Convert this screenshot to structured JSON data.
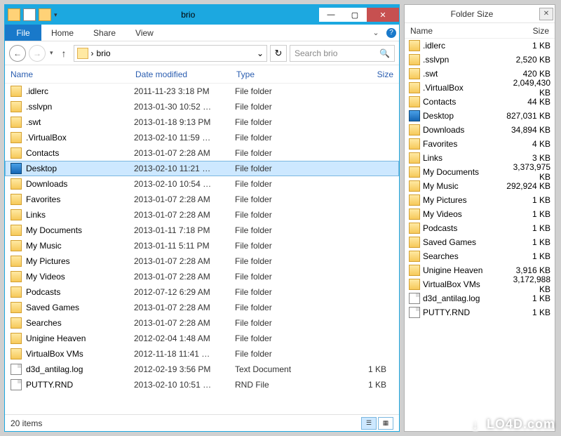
{
  "explorer": {
    "title": "brio",
    "ribbon": {
      "file": "File",
      "home": "Home",
      "share": "Share",
      "view": "View"
    },
    "address": {
      "crumb_sep": "›",
      "location": "brio",
      "dropdown_glyph": "⌄"
    },
    "search": {
      "placeholder": "Search brio"
    },
    "columns": {
      "name": "Name",
      "date": "Date modified",
      "type": "Type",
      "size": "Size"
    },
    "files": [
      {
        "icon": "folder",
        "name": ".idlerc",
        "date": "2011-11-23 3:18 PM",
        "type": "File folder",
        "size": ""
      },
      {
        "icon": "folder",
        "name": ".sslvpn",
        "date": "2013-01-30 10:52 …",
        "type": "File folder",
        "size": ""
      },
      {
        "icon": "folder",
        "name": ".swt",
        "date": "2013-01-18 9:13 PM",
        "type": "File folder",
        "size": ""
      },
      {
        "icon": "folder",
        "name": ".VirtualBox",
        "date": "2013-02-10 11:59 …",
        "type": "File folder",
        "size": ""
      },
      {
        "icon": "folder",
        "name": "Contacts",
        "date": "2013-01-07 2:28 AM",
        "type": "File folder",
        "size": ""
      },
      {
        "icon": "desktop",
        "name": "Desktop",
        "date": "2013-02-10 11:21 …",
        "type": "File folder",
        "size": "",
        "selected": true
      },
      {
        "icon": "folder",
        "name": "Downloads",
        "date": "2013-02-10 10:54 …",
        "type": "File folder",
        "size": ""
      },
      {
        "icon": "folder",
        "name": "Favorites",
        "date": "2013-01-07 2:28 AM",
        "type": "File folder",
        "size": ""
      },
      {
        "icon": "folder",
        "name": "Links",
        "date": "2013-01-07 2:28 AM",
        "type": "File folder",
        "size": ""
      },
      {
        "icon": "folder",
        "name": "My Documents",
        "date": "2013-01-11 7:18 PM",
        "type": "File folder",
        "size": ""
      },
      {
        "icon": "folder",
        "name": "My Music",
        "date": "2013-01-11 5:11 PM",
        "type": "File folder",
        "size": ""
      },
      {
        "icon": "folder",
        "name": "My Pictures",
        "date": "2013-01-07 2:28 AM",
        "type": "File folder",
        "size": ""
      },
      {
        "icon": "folder",
        "name": "My Videos",
        "date": "2013-01-07 2:28 AM",
        "type": "File folder",
        "size": ""
      },
      {
        "icon": "folder",
        "name": "Podcasts",
        "date": "2012-07-12 6:29 AM",
        "type": "File folder",
        "size": ""
      },
      {
        "icon": "folder",
        "name": "Saved Games",
        "date": "2013-01-07 2:28 AM",
        "type": "File folder",
        "size": ""
      },
      {
        "icon": "folder",
        "name": "Searches",
        "date": "2013-01-07 2:28 AM",
        "type": "File folder",
        "size": ""
      },
      {
        "icon": "folder",
        "name": "Unigine Heaven",
        "date": "2012-02-04 1:48 AM",
        "type": "File folder",
        "size": ""
      },
      {
        "icon": "folder",
        "name": "VirtualBox VMs",
        "date": "2012-11-18 11:41 …",
        "type": "File folder",
        "size": ""
      },
      {
        "icon": "doc",
        "name": "d3d_antilag.log",
        "date": "2012-02-19 3:56 PM",
        "type": "Text Document",
        "size": "1 KB"
      },
      {
        "icon": "doc",
        "name": "PUTTY.RND",
        "date": "2013-02-10 10:51 …",
        "type": "RND File",
        "size": "1 KB"
      }
    ],
    "status": "20 items"
  },
  "foldersize": {
    "title": "Folder Size",
    "columns": {
      "name": "Name",
      "size": "Size"
    },
    "rows": [
      {
        "icon": "folder",
        "name": ".idlerc",
        "size": "1 KB"
      },
      {
        "icon": "folder",
        "name": ".sslvpn",
        "size": "2,520 KB"
      },
      {
        "icon": "folder",
        "name": ".swt",
        "size": "420 KB"
      },
      {
        "icon": "folder",
        "name": ".VirtualBox",
        "size": "2,049,430 KB"
      },
      {
        "icon": "folder",
        "name": "Contacts",
        "size": "44 KB"
      },
      {
        "icon": "desktop",
        "name": "Desktop",
        "size": "827,031 KB"
      },
      {
        "icon": "folder",
        "name": "Downloads",
        "size": "34,894 KB"
      },
      {
        "icon": "folder",
        "name": "Favorites",
        "size": "4 KB"
      },
      {
        "icon": "folder",
        "name": "Links",
        "size": "3 KB"
      },
      {
        "icon": "folder",
        "name": "My Documents",
        "size": "3,373,975 KB"
      },
      {
        "icon": "folder",
        "name": "My Music",
        "size": "292,924 KB"
      },
      {
        "icon": "folder",
        "name": "My Pictures",
        "size": "1 KB"
      },
      {
        "icon": "folder",
        "name": "My Videos",
        "size": "1 KB"
      },
      {
        "icon": "folder",
        "name": "Podcasts",
        "size": "1 KB"
      },
      {
        "icon": "folder",
        "name": "Saved Games",
        "size": "1 KB"
      },
      {
        "icon": "folder",
        "name": "Searches",
        "size": "1 KB"
      },
      {
        "icon": "folder",
        "name": "Unigine Heaven",
        "size": "3,916 KB"
      },
      {
        "icon": "folder",
        "name": "VirtualBox VMs",
        "size": "3,172,988 KB"
      },
      {
        "icon": "doc",
        "name": "d3d_antilag.log",
        "size": "1 KB"
      },
      {
        "icon": "doc",
        "name": "PUTTY.RND",
        "size": "1 KB"
      }
    ]
  },
  "watermark": "LO4D.com"
}
